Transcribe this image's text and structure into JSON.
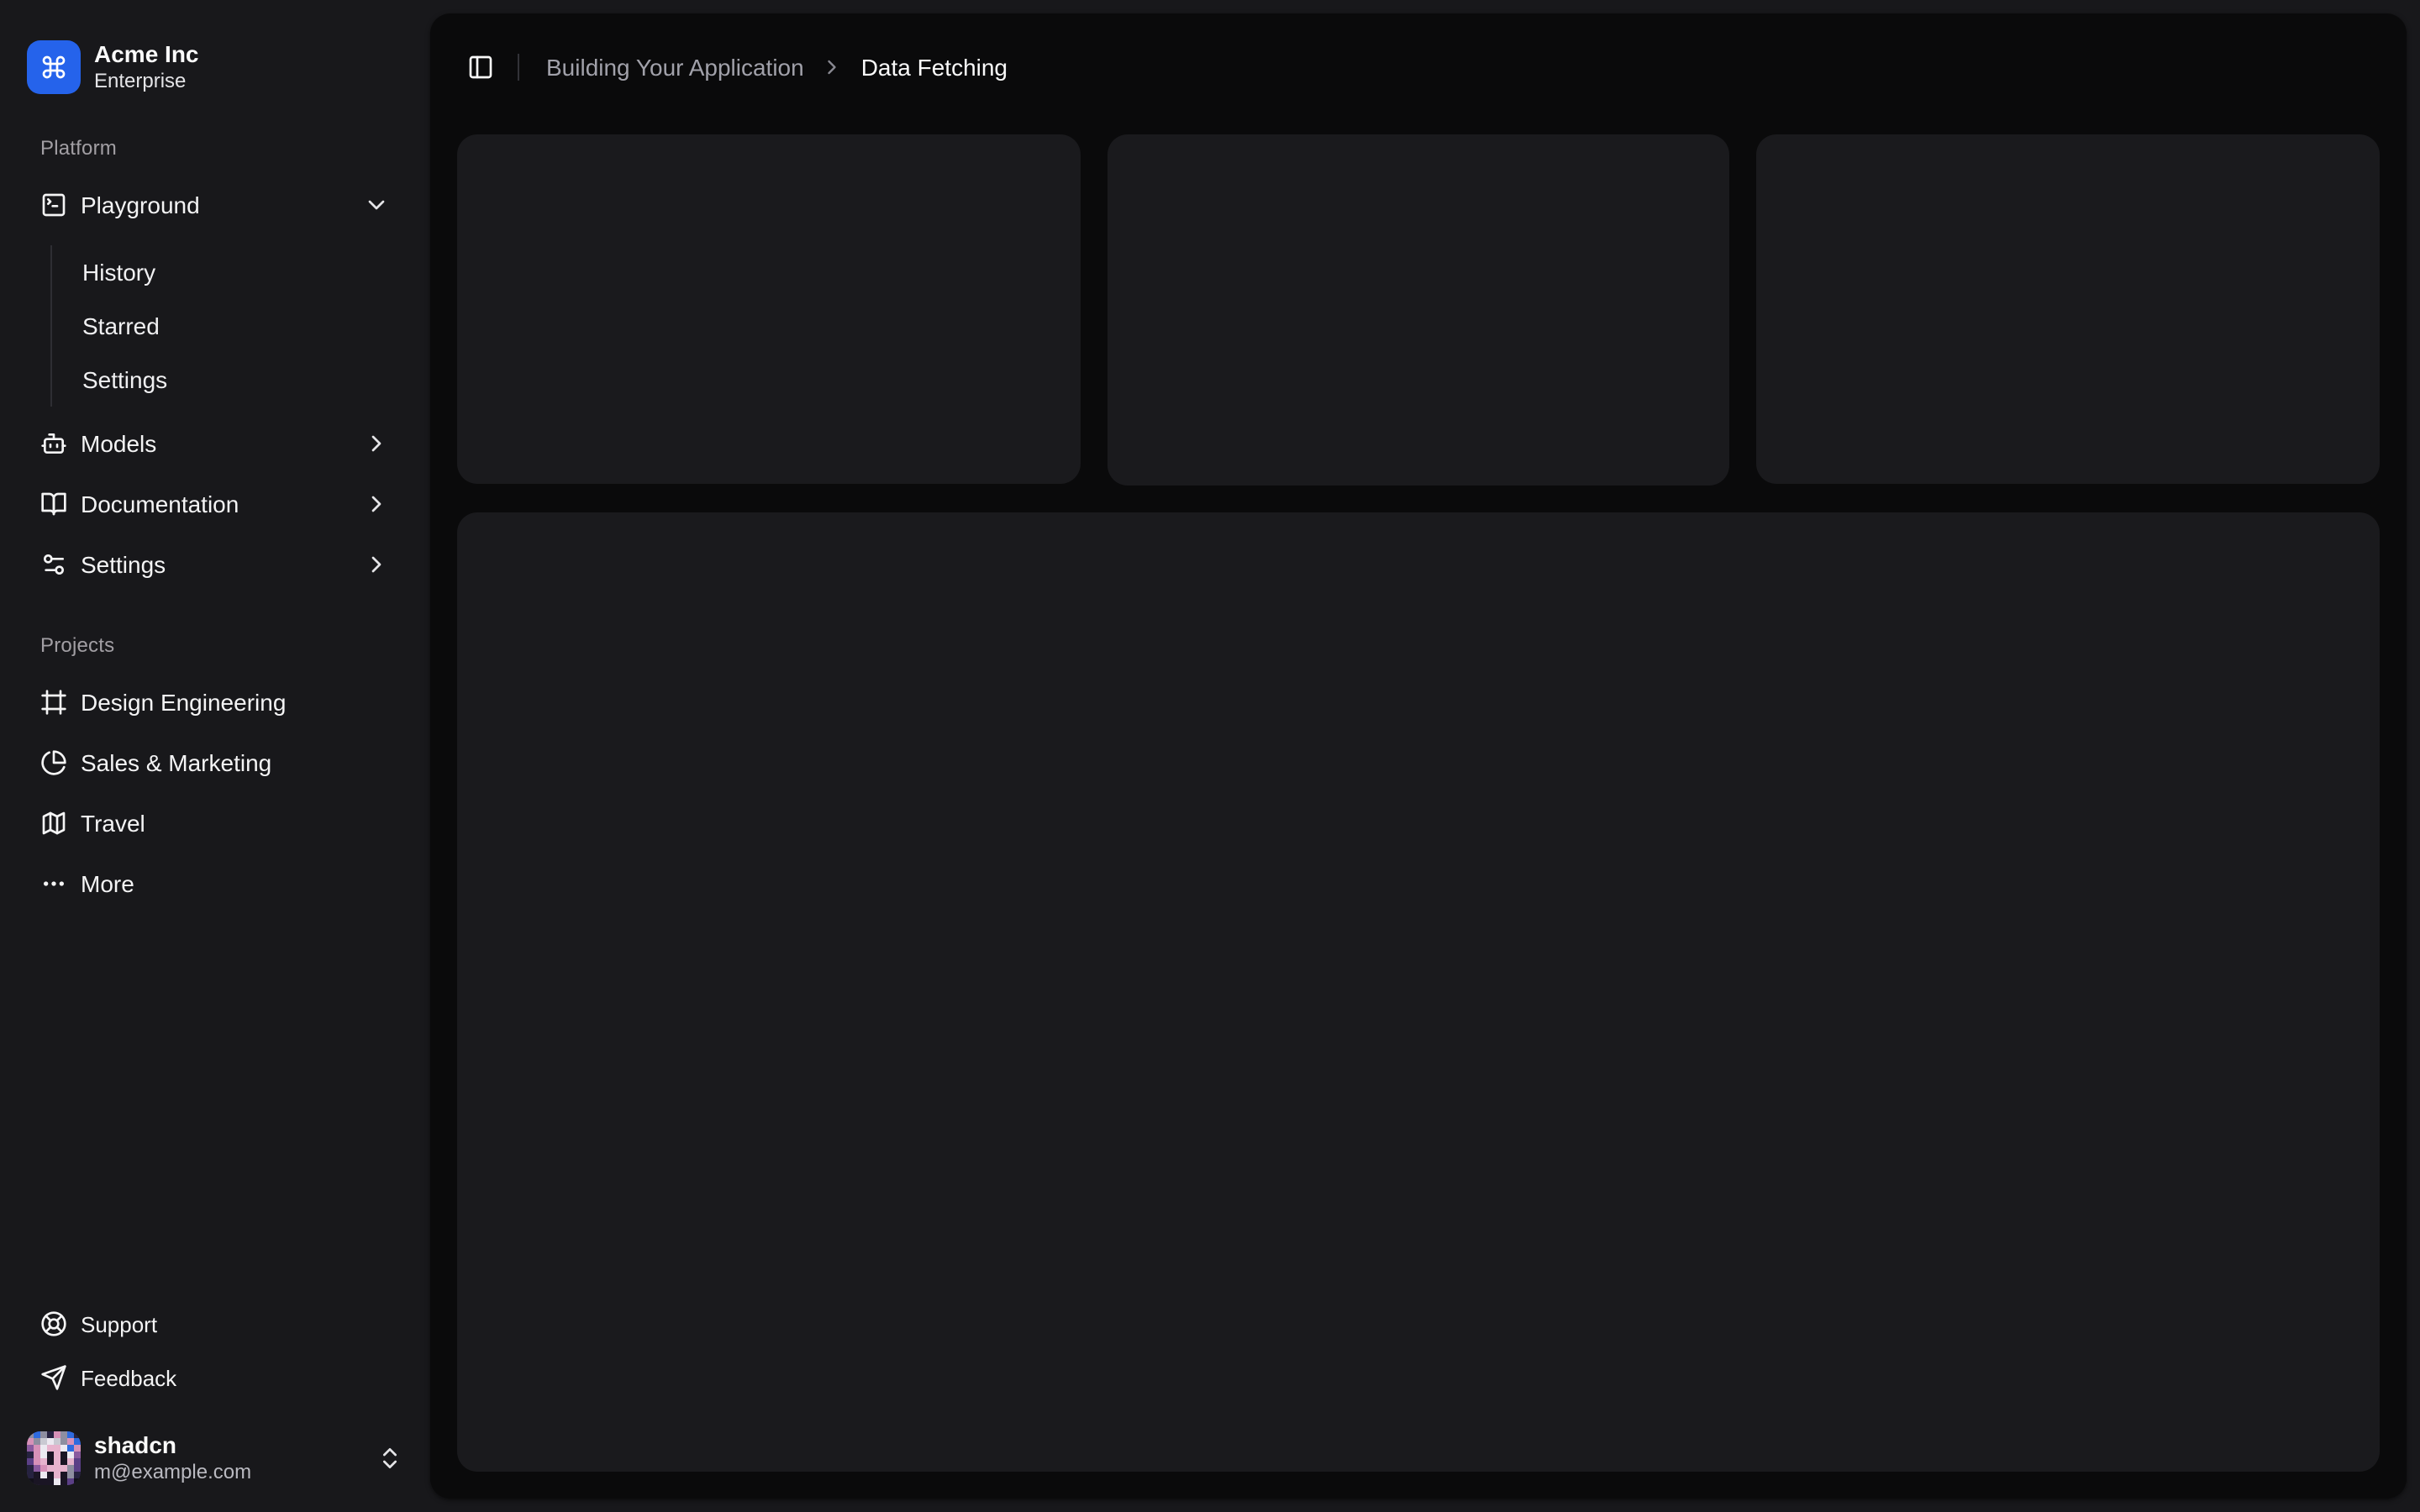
{
  "brand": {
    "name": "Acme Inc",
    "plan": "Enterprise",
    "logo_icon": "command-icon",
    "logo_color": "#2563eb"
  },
  "nav": {
    "groups": [
      {
        "label": "Platform",
        "items": [
          {
            "label": "Playground",
            "icon": "square-terminal-icon",
            "state": "expanded",
            "children": [
              {
                "label": "History"
              },
              {
                "label": "Starred"
              },
              {
                "label": "Settings"
              }
            ]
          },
          {
            "label": "Models",
            "icon": "bot-icon",
            "state": "collapsed"
          },
          {
            "label": "Documentation",
            "icon": "book-open-icon",
            "state": "collapsed"
          },
          {
            "label": "Settings",
            "icon": "settings-icon",
            "state": "collapsed"
          }
        ]
      },
      {
        "label": "Projects",
        "items": [
          {
            "label": "Design Engineering",
            "icon": "frame-icon"
          },
          {
            "label": "Sales & Marketing",
            "icon": "pie-chart-icon"
          },
          {
            "label": "Travel",
            "icon": "map-icon"
          },
          {
            "label": "More",
            "icon": "ellipsis-icon"
          }
        ]
      }
    ],
    "secondary": [
      {
        "label": "Support",
        "icon": "life-buoy-icon"
      },
      {
        "label": "Feedback",
        "icon": "send-icon"
      }
    ]
  },
  "user": {
    "name": "shadcn",
    "email": "m@example.com",
    "avatar": {
      "palette": {
        "g": "#8e8ea0",
        "G": "#c9c9d2",
        "b": "#2f6bdf",
        "n": "#262240",
        "p": "#d791b8",
        "P": "#e7b3cd",
        "m": "#8a5a9e",
        "d": "#1a1524",
        "w": "#ece9f1",
        "v": "#5b3f86",
        "k": "#12101a"
      },
      "rows": [
        "gbgnpgbn",
        "pgGwGgpb",
        "mpwPPwbp",
        "npwdPdwm",
        "vpPdPdPv",
        "nmpPPPgv",
        "ndwdPdgn",
        "kdddwdvk"
      ]
    }
  },
  "header": {
    "breadcrumb": {
      "parent": "Building Your Application",
      "current": "Data Fetching"
    }
  },
  "main": {
    "placeholder_cards": 3,
    "colors": {
      "sidebar_bg": "#18181b",
      "inset_bg": "#0a0a0b",
      "card_bg": "#1a1a1d",
      "text": "#fafafa",
      "muted_text": "#a1a1aa"
    }
  }
}
